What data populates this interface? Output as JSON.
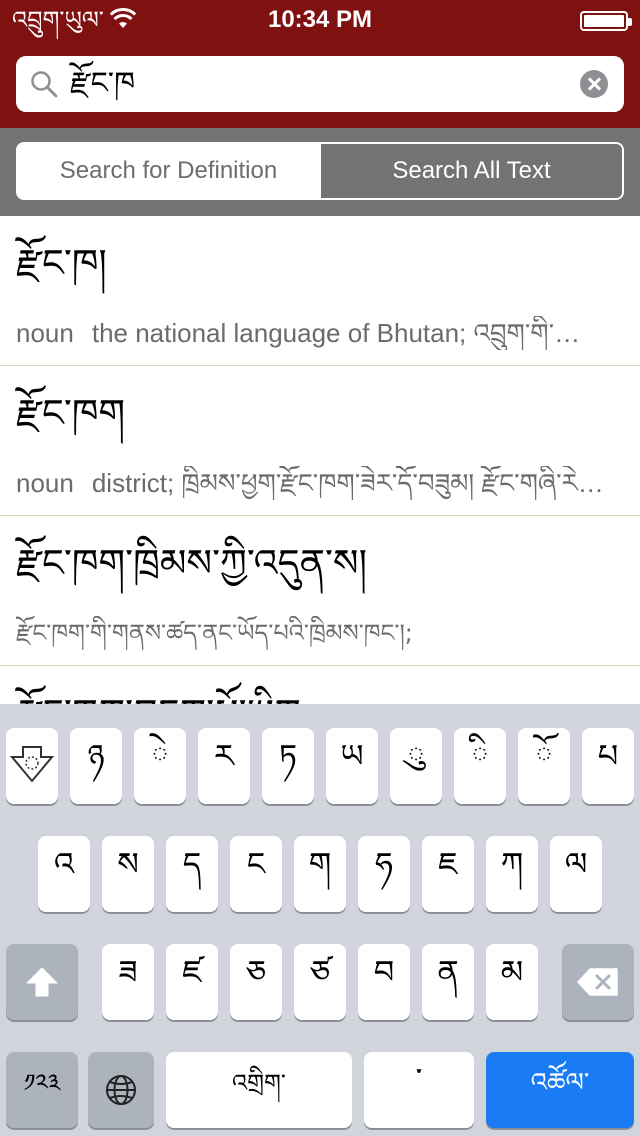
{
  "status_bar": {
    "carrier": "འབྲུག་ཡུལ་",
    "time": "10:34 PM",
    "battery_level": 100
  },
  "search": {
    "query": "རྫོང་ཁ",
    "icon": "search-icon"
  },
  "segments": {
    "definition": "Search for Definition",
    "all_text": "Search All Text",
    "selected": "Search All Text"
  },
  "results": [
    {
      "headword": "རྫོང་ཁ།",
      "pos": "noun",
      "definition": "the national language of Bhutan; འབྲུག་གི་…"
    },
    {
      "headword": "རྫོང་ཁག",
      "pos": "noun",
      "definition": "district; ཁྲིམས་ཕྱག་རྫོང་ཁག་ཟེར་དོ་བཟུམ། རྫོང་གཞི་རེ…"
    },
    {
      "headword": "རྫོང་ཁག་ཁྲིམས་ཀྱི་འདུན་ས།",
      "pos": "",
      "definition": "རྫོང་ཁག་གི་གནས་ཚད་ནང་ཡོད་པའི་ཁྲིམས་ཁང་།;"
    },
    {
      "headword": "རྫོང་ཁག་བདག་པོ་ཡིག",
      "pos": "",
      "definition": ""
    }
  ],
  "keyboard": {
    "row1": [
      "ཉ",
      "ེ",
      "ར",
      "ཏ",
      "ཡ",
      "ུ",
      "ི",
      "ོ",
      "པ"
    ],
    "row2": [
      "འ",
      "ས",
      "ད",
      "ང",
      "ག",
      "ཧ",
      "ཇ",
      "ཀ",
      "ལ"
    ],
    "row3": [
      "ཟ",
      "ཛ",
      "ཅ",
      "ཙ",
      "བ",
      "ན",
      "མ"
    ],
    "numbers_key": "༡༢༣",
    "space_label": "འགྲིག་",
    "tsheg_label": "་",
    "return_label": "འཚོལ་",
    "icons": {
      "dismiss": "keyboard-dismiss-icon",
      "shift": "shift-icon",
      "delete": "delete-icon",
      "globe": "globe-icon"
    }
  },
  "colors": {
    "header": "#7f1111",
    "segment_bg": "#737373",
    "keyboard_bg": "#d1d5db",
    "return_key": "#1a7cf5"
  }
}
